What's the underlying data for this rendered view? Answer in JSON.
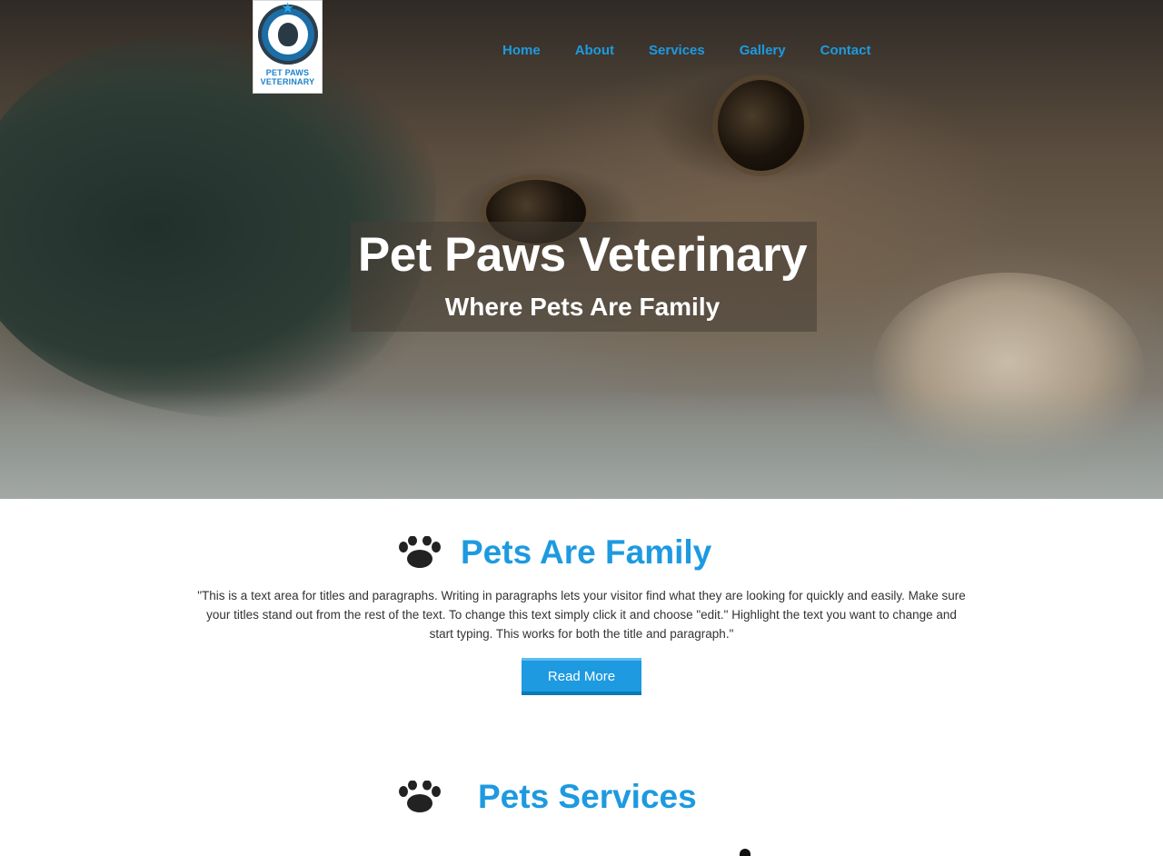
{
  "brand": {
    "logo_line1": "PET PAWS",
    "logo_line2": "VETERINARY",
    "accent_color": "#1d9ae0"
  },
  "nav": {
    "items": [
      "Home",
      "About",
      "Services",
      "Gallery",
      "Contact"
    ]
  },
  "hero": {
    "title": "Pet Paws Veterinary",
    "subtitle": "Where Pets Are Family"
  },
  "intro": {
    "icon": "paw-icon",
    "title": "Pets Are Family",
    "body": "\"This is a text area for titles and paragraphs. Writing in paragraphs lets your visitor find what they are looking for quickly and easily. Make sure your titles stand out from the rest of the text. To change this text simply click it and choose \"edit.\" Highlight the text you want to change and start typing. This works for both the title and paragraph.\"",
    "button_label": "Read More"
  },
  "services": {
    "icon": "paw-icon",
    "title": "Pets Services"
  }
}
